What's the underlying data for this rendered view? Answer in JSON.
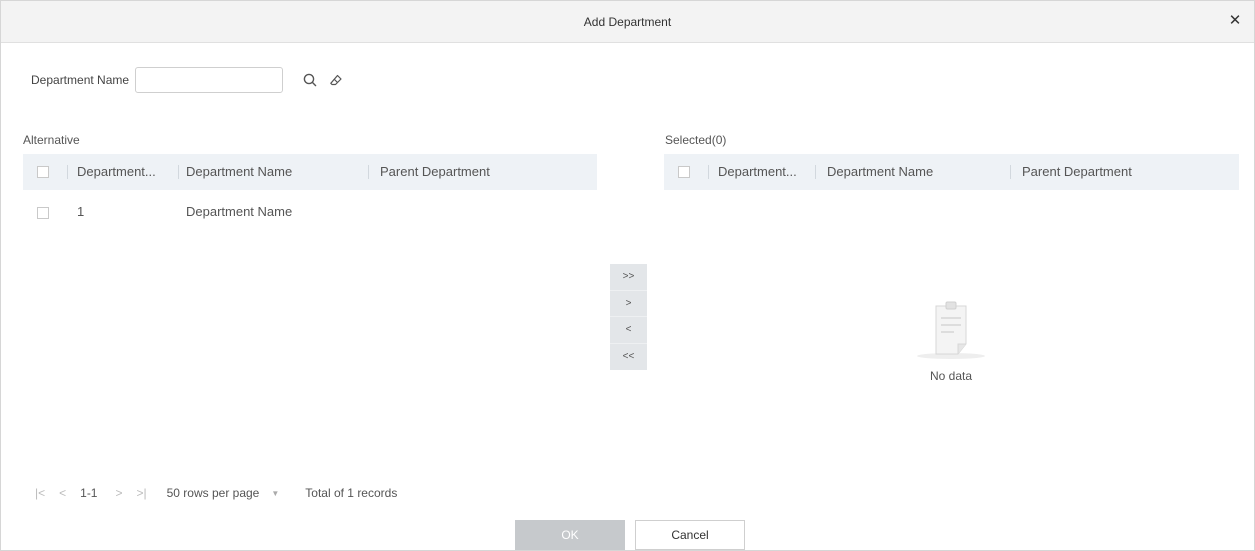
{
  "dialog": {
    "title": "Add Department",
    "close_icon": "close-icon"
  },
  "search": {
    "label": "Department Name",
    "value": "",
    "placeholder": "",
    "search_icon": "search-icon",
    "clear_icon": "eraser-icon"
  },
  "alternative": {
    "label": "Alternative",
    "columns": [
      "Department...",
      "Department Name",
      "Parent Department"
    ],
    "rows": [
      {
        "number": "1",
        "name": "Department Name",
        "parent": ""
      }
    ]
  },
  "selected": {
    "label": "Selected(0)",
    "columns": [
      "Department...",
      "Department Name",
      "Parent Department"
    ],
    "rows": [],
    "empty_text": "No data",
    "empty_icon": "clipboard-icon"
  },
  "transfer": {
    "move_all_right": ">>",
    "move_right": ">",
    "move_left": "<",
    "move_all_left": "<<"
  },
  "pager": {
    "first": "|<",
    "prev": "<",
    "range": "1-1",
    "next": ">",
    "last": ">|",
    "rows_per_page": "50 rows per page",
    "total": "Total of 1 records"
  },
  "buttons": {
    "ok": "OK",
    "cancel": "Cancel"
  }
}
